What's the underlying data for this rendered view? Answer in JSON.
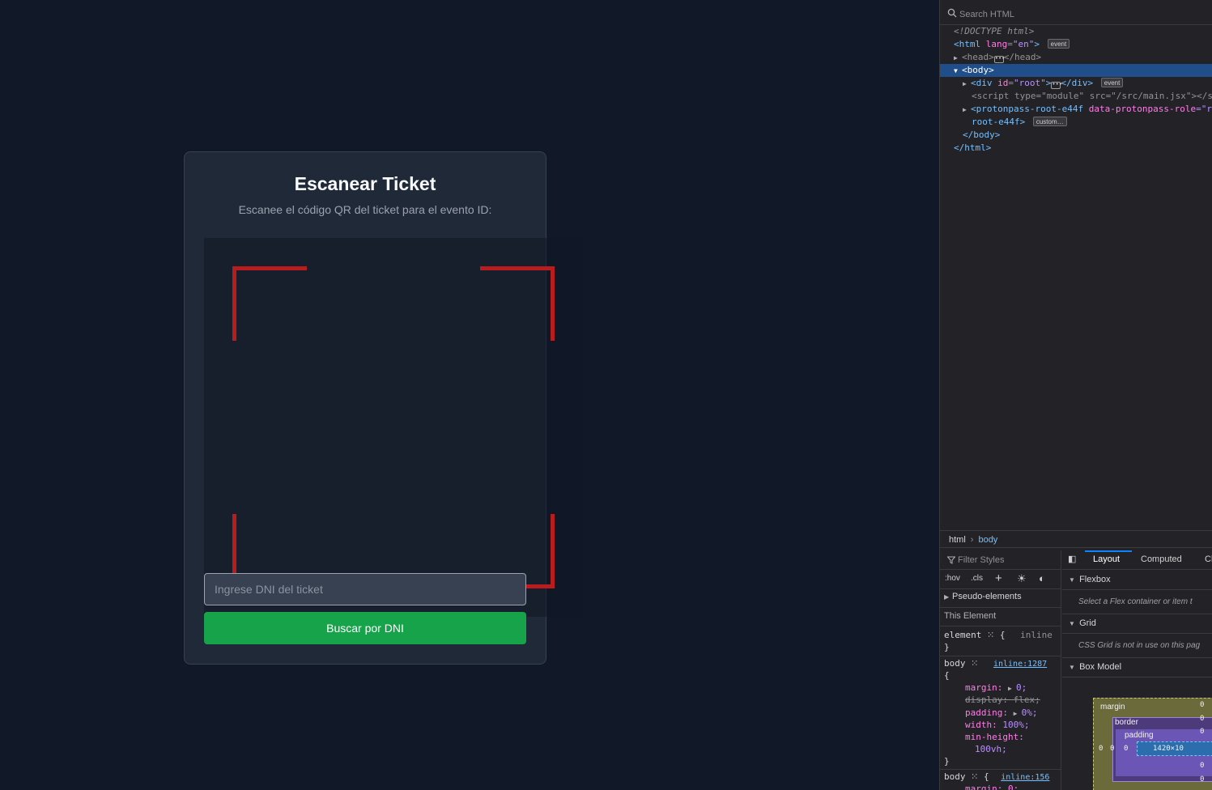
{
  "app": {
    "title": "Escanear Ticket",
    "subtitle": "Escanee el código QR del ticket para el evento ID:",
    "dni_placeholder": "Ingrese DNI del ticket",
    "dni_value": "",
    "search_button": "Buscar por DNI",
    "colors": {
      "background": "#111827",
      "card": "#1f2937",
      "scan_corner": "#b91c1c",
      "button": "#16a34a"
    }
  },
  "devtools": {
    "search_placeholder": "Search HTML",
    "tree": {
      "doctype": "<!DOCTYPE html>",
      "html_open": "<html",
      "html_lang_attr": "lang",
      "html_lang_val": "\"en\"",
      "html_close_bracket": ">",
      "badge_event": "event",
      "head_open": "<head>",
      "head_close": "</head>",
      "body_open": "<body>",
      "div_open": "<div",
      "div_id_attr": "id",
      "div_id_val": "\"root\"",
      "div_gt": ">",
      "div_close": "</div>",
      "script_text": "<script type=\"module\" src=\"/src/main.jsx\"></s",
      "proton_open": "<protonpass-root-e44f",
      "proton_attr": "data-protonpass-role",
      "proton_attr_tail": "=\"r",
      "proton_line2": "root-e44f>",
      "badge_custom": "custom…",
      "body_close": "</body>",
      "html_close": "</html>"
    },
    "breadcrumb": [
      "html",
      "body"
    ],
    "rules": {
      "filter_placeholder": "Filter Styles",
      "hov": ":hov",
      "cls": ".cls",
      "pseudo_elements": "Pseudo-elements",
      "this_element": "This Element",
      "element_selector": "element",
      "element_brace": "{",
      "element_inline": "inline",
      "close_brace": "}",
      "body_selector": "body",
      "open_brace": "{",
      "inline_1287": "inline:1287",
      "inline_156": "inline:156",
      "decl_margin": "margin:",
      "decl_margin_val": "0;",
      "decl_display": "display: flex;",
      "decl_padding": "padding:",
      "decl_padding_val": "0%;",
      "decl_width": "width:",
      "decl_width_val": "100%;",
      "decl_minheight": "min-height:",
      "decl_minheight_val": "100vh;",
      "body2_tail": "margin: 0;"
    },
    "layout": {
      "tabs": [
        "Layout",
        "Computed",
        "Cl"
      ],
      "active_tab": "Layout",
      "flexbox_header": "Flexbox",
      "flexbox_note": "Select a Flex container or item t",
      "grid_header": "Grid",
      "grid_note": "CSS Grid is not in use on this pag",
      "boxmodel_header": "Box Model",
      "margin_label": "margin",
      "border_label": "border",
      "padding_label": "padding",
      "content_size": "1420×10",
      "zero": "0"
    }
  }
}
